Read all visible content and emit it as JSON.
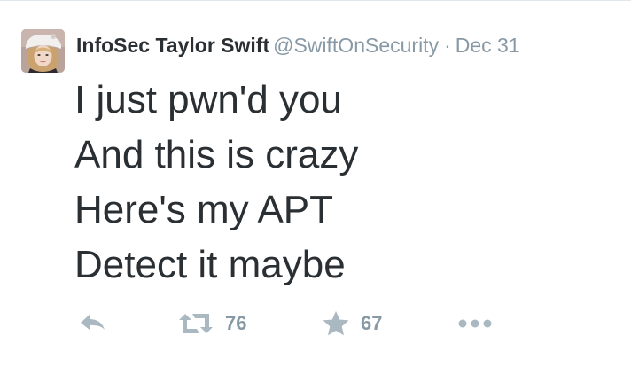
{
  "tweet": {
    "author": {
      "display_name": "InfoSec Taylor Swift",
      "username": "@SwiftOnSecurity"
    },
    "separator": "·",
    "timestamp": "Dec 31",
    "text_lines": [
      "I just pwn'd you",
      "And this is crazy",
      "Here's my APT",
      "Detect it maybe"
    ],
    "actions": {
      "retweet_count": "76",
      "favorite_count": "67"
    }
  },
  "colors": {
    "text_primary": "#292f33",
    "text_secondary": "#8899a6",
    "icon_gray": "#aab8c2"
  },
  "icons": [
    "reply-icon",
    "retweet-icon",
    "favorite-icon",
    "more-icon"
  ]
}
